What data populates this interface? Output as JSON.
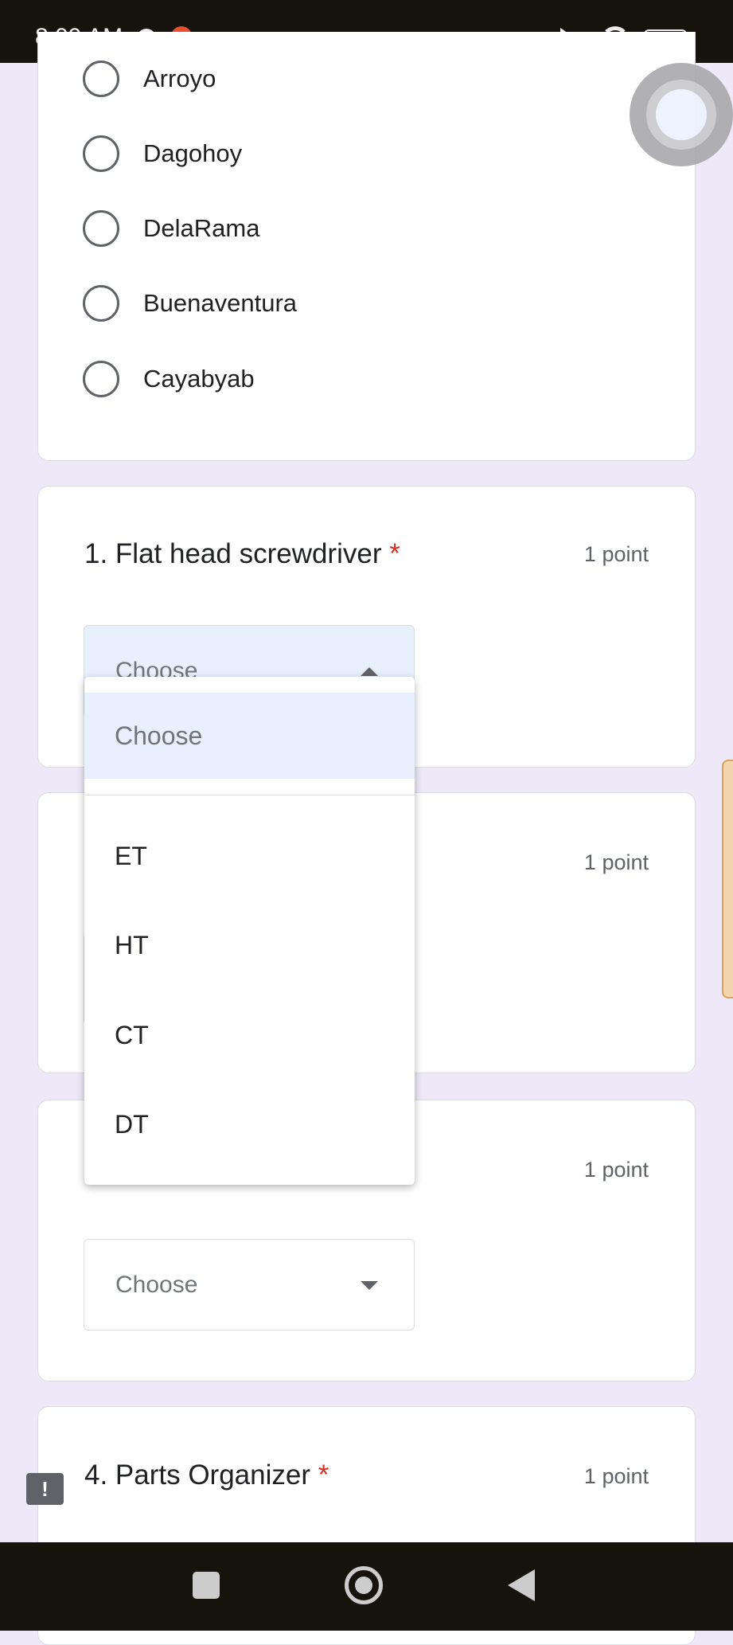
{
  "status_bar": {
    "time": "8:09 AM",
    "battery": "59",
    "icons": [
      "messenger-icon",
      "shopee-icon",
      "game-controller-icon",
      "dot-icon",
      "signal-icon",
      "wifi-icon",
      "battery-icon"
    ]
  },
  "previous_question": {
    "options": [
      "Arroyo",
      "Dagohoy",
      "DelaRama",
      "Buenaventura",
      "Cayabyab"
    ]
  },
  "questions": [
    {
      "title": "1.  Flat head screwdriver",
      "required": "*",
      "points": "1 point",
      "selected": "Choose"
    },
    {
      "points": "1 point"
    },
    {
      "points": "1 point",
      "selected": "Choose"
    },
    {
      "title": "4. Parts Organizer",
      "required": "*",
      "points": "1 point"
    }
  ],
  "dropdown": {
    "placeholder": "Choose",
    "options": [
      "ET",
      "HT",
      "CT",
      "DT"
    ]
  },
  "colors": {
    "background": "#ede9f8",
    "highlight": "#e8f0fe",
    "required": "#d93025"
  }
}
